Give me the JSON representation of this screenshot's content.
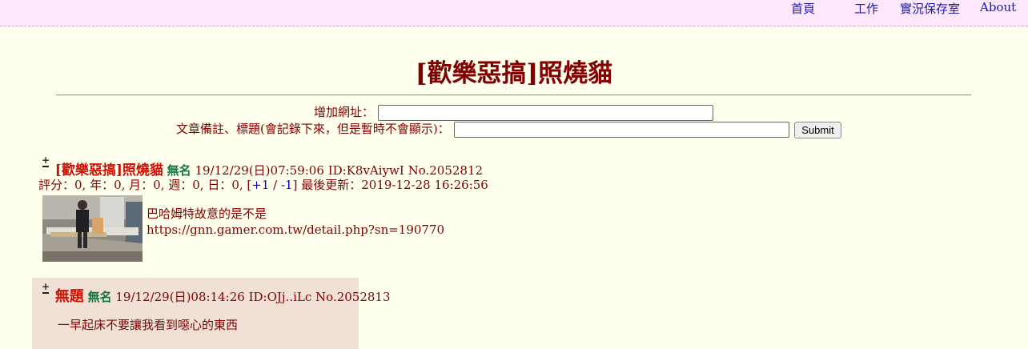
{
  "nav": {
    "home": "首頁",
    "work": "工作",
    "live_archive": "實況保存室",
    "about": "About"
  },
  "page_title": "[歡樂惡搞]照燒貓",
  "form": {
    "url_label": "增加網址：",
    "url_value": "",
    "note_label": "文章備註、標題(會記錄下來，但是暫時不會顯示)：",
    "note_value": "",
    "submit_label": "Submit"
  },
  "op": {
    "title": "[歡樂惡搞]照燒貓",
    "name": "無名",
    "datetime": "19/12/29(日)07:59:06",
    "id": "ID:K8vAiywI",
    "number": "No.2052812",
    "rating_prefix": "評分：0, 年：0, 月：0, 週：0, 日：0, [",
    "vote_up": "+1",
    "vote_sep": " / ",
    "vote_down": "-1",
    "rating_suffix": "] 最後更新：2019-12-28 16:26:56",
    "body_line1": "巴哈姆特故意的是不是",
    "body_line2": "https://gnn.gamer.com.tw/detail.php?sn=190770"
  },
  "reply": {
    "title": "無題",
    "name": "無名",
    "datetime": "19/12/29(日)08:14:26",
    "id": "ID:OJj..iLc",
    "number": "No.2052813",
    "body": "一早起床不要讓我看到噁心的東西"
  }
}
